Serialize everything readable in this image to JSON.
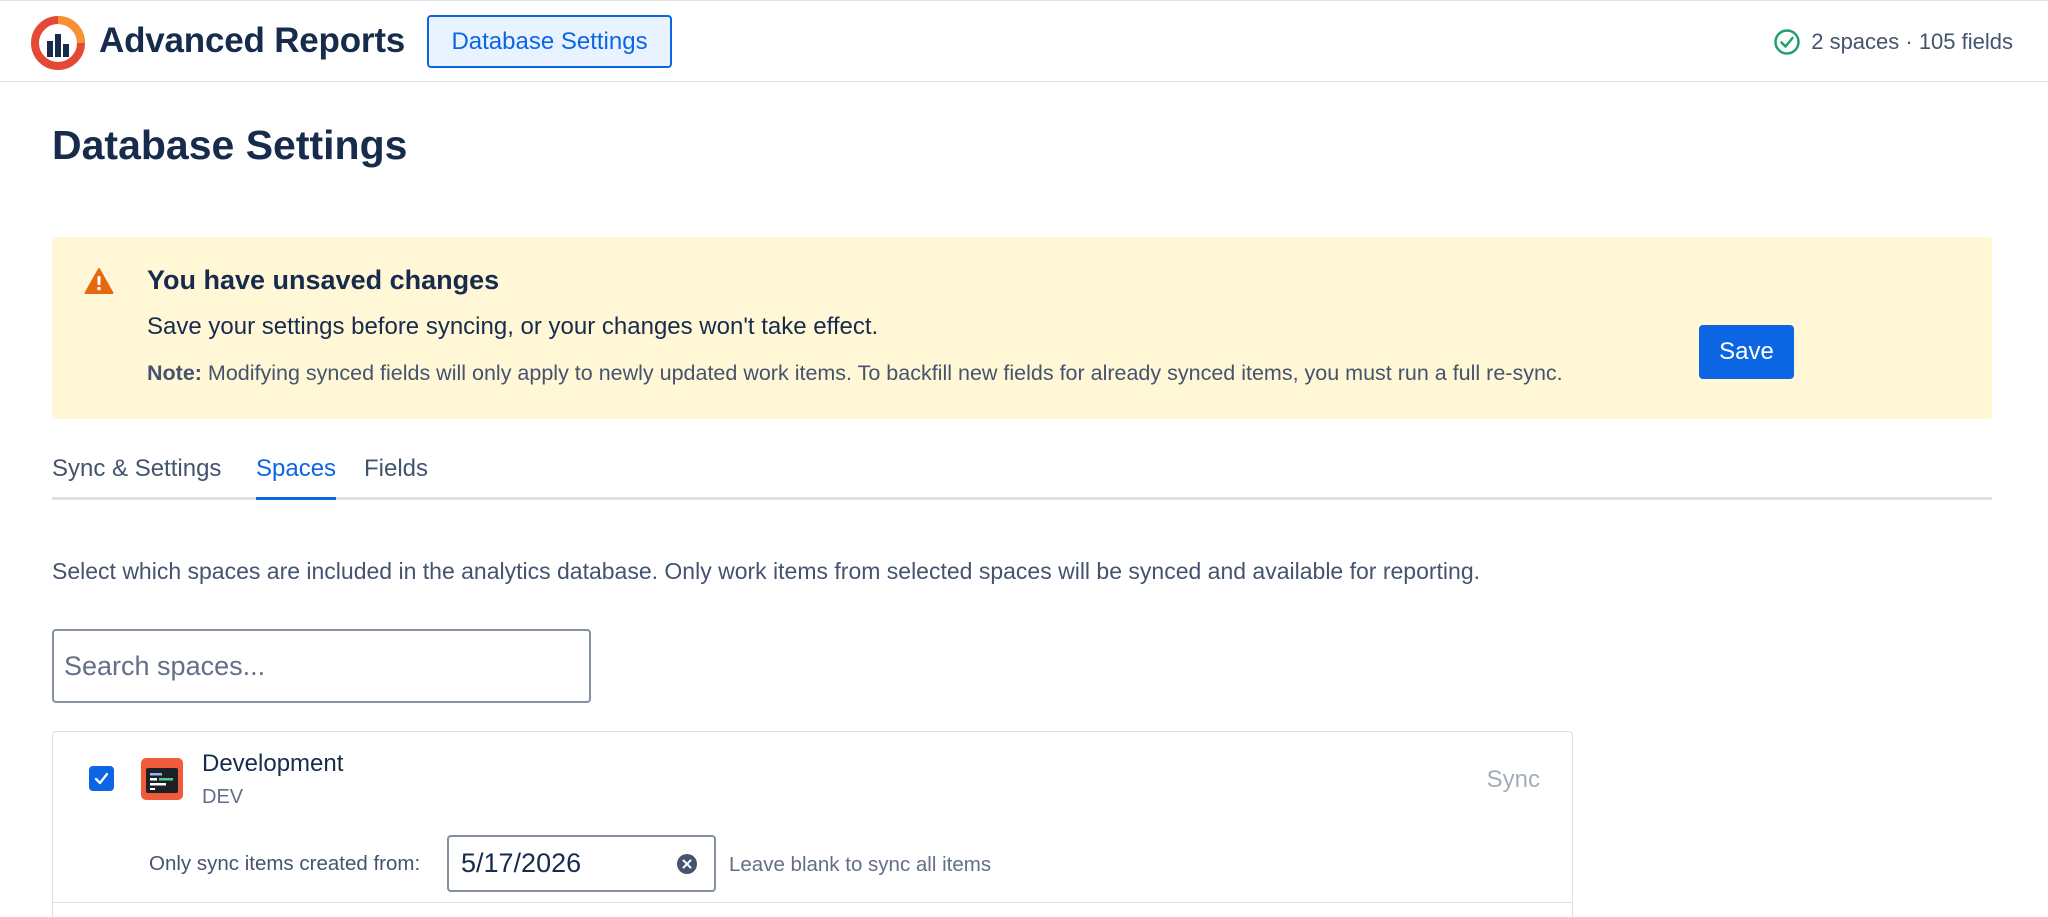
{
  "header": {
    "app_title": "Advanced Reports",
    "nav_button": "Database Settings",
    "status_text": "2 spaces · 105 fields",
    "status_icon": "check-circle-icon",
    "status_color": "#22a06b"
  },
  "page": {
    "title": "Database Settings"
  },
  "banner": {
    "icon": "warning-icon",
    "title": "You have unsaved changes",
    "text": "Save your settings before syncing, or your changes won't take effect.",
    "note_label": "Note:",
    "note_text": "Modifying synced fields will only apply to newly updated work items. To backfill new fields for already synced items, you must run a full re-sync.",
    "save_label": "Save",
    "background": "#fff7d6",
    "icon_color": "#e56910"
  },
  "tabs": [
    {
      "label": "Sync & Settings",
      "active": false
    },
    {
      "label": "Spaces",
      "active": true
    },
    {
      "label": "Fields",
      "active": false
    }
  ],
  "spaces_section": {
    "description": "Select which spaces are included in the analytics database. Only work items from selected spaces will be synced and available for reporting.",
    "search_placeholder": "Search spaces...",
    "items": [
      {
        "checked": true,
        "name": "Development",
        "key": "DEV",
        "sync_label": "Sync",
        "date_label": "Only sync items created from:",
        "date_value": "5/17/2026",
        "date_hint": "Leave blank to sync all items"
      }
    ]
  },
  "colors": {
    "accent": "#0c66e4",
    "text": "#172b4d",
    "subtle_text": "#44546f"
  }
}
